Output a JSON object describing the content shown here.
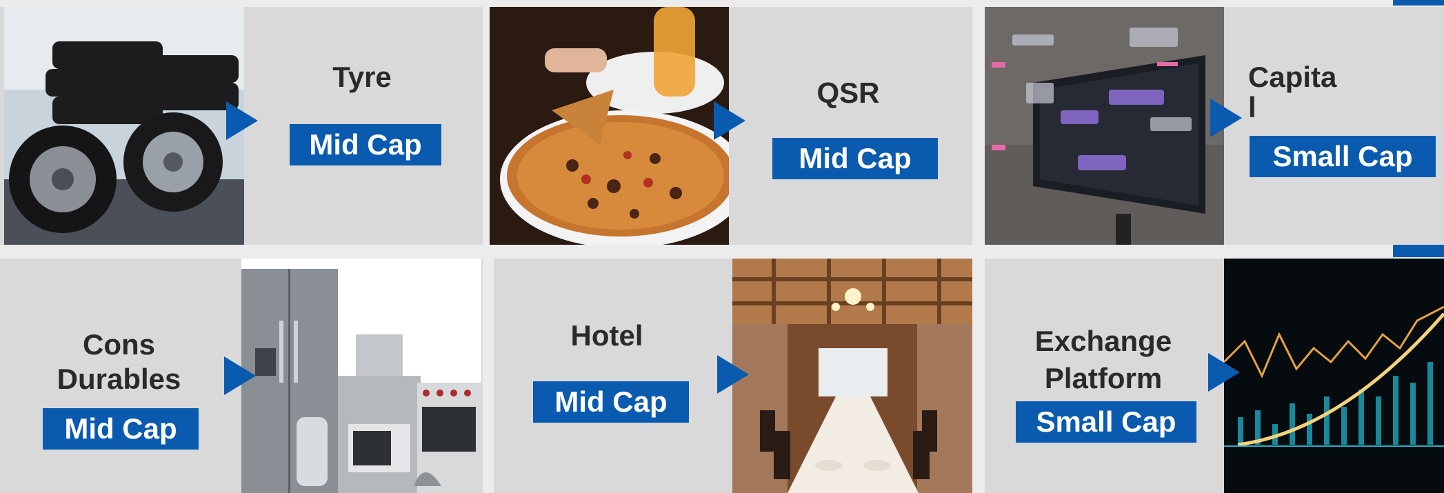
{
  "colors": {
    "accent": "#0a5bb0",
    "card_bg": "#d9d9d9",
    "text": "#2a2a2a",
    "page_bg": "#ececec"
  },
  "tiles": [
    {
      "title": "Tyre",
      "badge": "Mid Cap",
      "image": "tyre-stack-photo"
    },
    {
      "title": "QSR",
      "badge": "Mid Cap",
      "image": "pizza-photo"
    },
    {
      "title": "Capita\nl",
      "badge": "Small Cap",
      "image": "touchscreen-ui-photo"
    },
    {
      "title": "Cons\nDurables",
      "badge": "Mid Cap",
      "image": "home-appliances-photo"
    },
    {
      "title": "Hotel",
      "badge": "Mid Cap",
      "image": "banquet-hall-photo"
    },
    {
      "title": "Exchange\nPlatform",
      "badge": "Small Cap",
      "image": "stock-chart-photo"
    }
  ]
}
